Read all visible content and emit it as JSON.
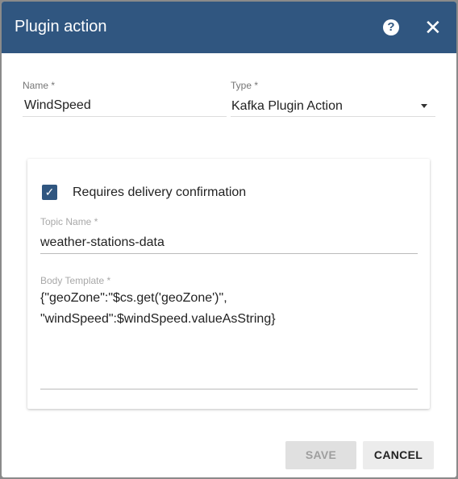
{
  "dialog": {
    "title": "Plugin action",
    "help_icon": "help-circle-icon",
    "close_icon": "close-icon"
  },
  "form": {
    "name": {
      "label": "Name *",
      "value": "WindSpeed"
    },
    "type": {
      "label": "Type *",
      "value": "Kafka Plugin Action"
    },
    "delivery": {
      "label": "Requires delivery confirmation",
      "checked": true
    },
    "topic": {
      "label": "Topic Name *",
      "value": "weather-stations-data"
    },
    "body": {
      "label": "Body Template *",
      "line1": "{\"geoZone\":\"$cs.get('geoZone')\",",
      "line2": "\"windSpeed\":$windSpeed.valueAsString}"
    }
  },
  "actions": {
    "save": "SAVE",
    "cancel": "CANCEL"
  },
  "colors": {
    "primary": "#305680"
  }
}
